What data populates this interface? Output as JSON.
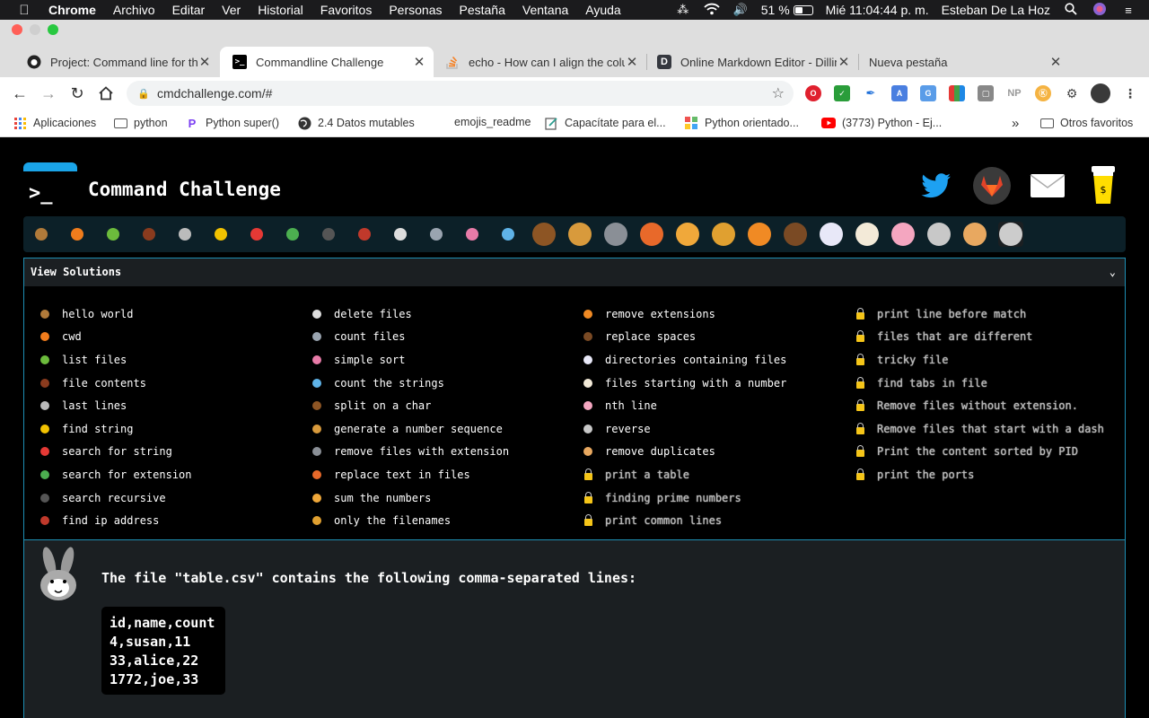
{
  "menubar": {
    "app": "Chrome",
    "items": [
      "Archivo",
      "Editar",
      "Ver",
      "Historial",
      "Favoritos",
      "Personas",
      "Pestaña",
      "Ventana",
      "Ayuda"
    ],
    "battery": "51 %",
    "battery_level": 0.51,
    "clock": "Mié 11:04:44 p. m.",
    "user": "Esteban De La Hoz"
  },
  "tabs": [
    {
      "title": "Project: Command line for the",
      "icon": "github-icon"
    },
    {
      "title": "Commandline Challenge",
      "icon": "terminal-icon",
      "active": true
    },
    {
      "title": "echo - How can I align the colu",
      "icon": "stackoverflow-icon"
    },
    {
      "title": "Online Markdown Editor - Dillin",
      "icon": "dillinger-icon"
    },
    {
      "title": "Nueva pestaña",
      "icon": ""
    }
  ],
  "address": {
    "url": "cmdchallenge.com/#"
  },
  "bookmarks": [
    {
      "label": "Aplicaciones",
      "icon": "apps-grid-icon"
    },
    {
      "label": "python",
      "icon": "folder-icon"
    },
    {
      "label": "Python super()",
      "icon": "pycharm-icon"
    },
    {
      "label": "2.4 Datos mutables",
      "icon": "globe-icon"
    },
    {
      "label": "emojis_readme",
      "icon": ""
    },
    {
      "label": "Capacítate para el...",
      "icon": "edit-icon"
    },
    {
      "label": "Python orientado...",
      "icon": "blocks-icon"
    },
    {
      "label": "(3773) Python - Ej...",
      "icon": "youtube-icon"
    },
    {
      "label": "Otros favoritos",
      "icon": "folder-icon"
    }
  ],
  "site": {
    "title": "Command Challenge",
    "logo_prompt": ">_",
    "accent": "#1aa4e8",
    "border": "#1e8fb3",
    "social": [
      "twitter-icon",
      "gitlab-icon",
      "mail-icon",
      "coffee-icon"
    ]
  },
  "solutions": {
    "header": "View Solutions",
    "columns": [
      [
        {
          "label": "hello world",
          "icon": "snail-icon"
        },
        {
          "label": "cwd",
          "icon": "butterfly-icon"
        },
        {
          "label": "list files",
          "icon": "caterpillar-icon"
        },
        {
          "label": "file contents",
          "icon": "ant-icon"
        },
        {
          "label": "last lines",
          "icon": "spider-web-icon"
        },
        {
          "label": "find string",
          "icon": "bee-icon"
        },
        {
          "label": "search for string",
          "icon": "ladybug-icon"
        },
        {
          "label": "search for extension",
          "icon": "lizard-icon"
        },
        {
          "label": "search recursive",
          "icon": "spider-icon"
        },
        {
          "label": "find ip address",
          "icon": "scorpion-icon"
        }
      ],
      [
        {
          "label": "delete files",
          "icon": "bird-icon"
        },
        {
          "label": "count files",
          "icon": "fly-icon"
        },
        {
          "label": "simple sort",
          "icon": "worm-icon"
        },
        {
          "label": "count the strings",
          "icon": "microbe-icon"
        },
        {
          "label": "split on a char",
          "icon": "monkey-icon"
        },
        {
          "label": "generate a number sequence",
          "icon": "dog-icon"
        },
        {
          "label": "remove files with extension",
          "icon": "wolf-icon"
        },
        {
          "label": "replace text in files",
          "icon": "fox-icon"
        },
        {
          "label": "sum the numbers",
          "icon": "cat-icon"
        },
        {
          "label": "only the filenames",
          "icon": "lion-icon"
        }
      ],
      [
        {
          "label": "remove extensions",
          "icon": "tiger-icon"
        },
        {
          "label": "replace spaces",
          "icon": "horse-icon"
        },
        {
          "label": "directories containing files",
          "icon": "unicorn-icon"
        },
        {
          "label": "files starting with a number",
          "icon": "cow-icon"
        },
        {
          "label": "nth line",
          "icon": "pig-icon"
        },
        {
          "label": "reverse",
          "icon": "mouse-icon"
        },
        {
          "label": "remove duplicates",
          "icon": "hamster-icon"
        },
        {
          "label": "print a table",
          "icon": "lock-icon",
          "locked": true
        },
        {
          "label": "finding prime numbers",
          "icon": "lock-icon",
          "locked": true
        },
        {
          "label": "print common lines",
          "icon": "lock-icon",
          "locked": true
        }
      ],
      [
        {
          "label": "print line before match",
          "icon": "lock-icon",
          "locked": true
        },
        {
          "label": "files that are different",
          "icon": "lock-icon",
          "locked": true
        },
        {
          "label": "tricky file",
          "icon": "lock-icon",
          "locked": true
        },
        {
          "label": "find tabs in file",
          "icon": "lock-icon",
          "locked": true
        },
        {
          "label": "Remove files without extension.",
          "icon": "lock-icon",
          "locked": true
        },
        {
          "label": "Remove files that start with a dash",
          "icon": "lock-icon",
          "locked": true
        },
        {
          "label": "Print the content sorted by PID",
          "icon": "lock-icon",
          "locked": true
        },
        {
          "label": "print the ports",
          "icon": "lock-icon",
          "locked": true
        }
      ]
    ]
  },
  "challenge": {
    "avatar": "rabbit-icon",
    "description": "The file \"table.csv\" contains the following comma-separated lines:",
    "code_lines": [
      "id,name,count",
      "4,susan,11",
      "33,alice,22",
      "1772,joe,33"
    ]
  }
}
